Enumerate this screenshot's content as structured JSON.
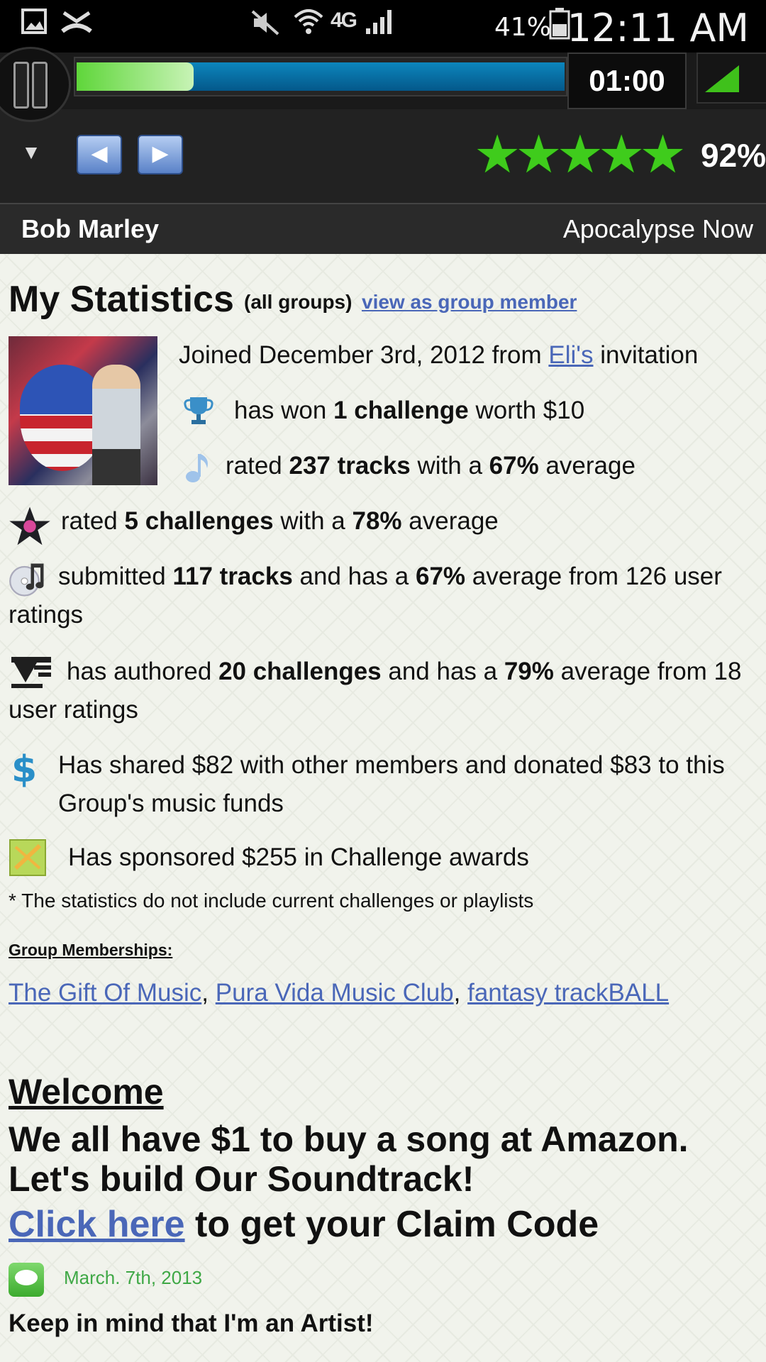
{
  "status_bar": {
    "time": "12:11 AM",
    "battery": "41%",
    "network": "4G",
    "icons": [
      "gallery-icon",
      "missed-call-icon",
      "mute-icon",
      "wifi-icon",
      "signal-icon",
      "battery-icon"
    ]
  },
  "player": {
    "elapsed": "01:00",
    "progress_fraction": 0.24,
    "rating_stars": 5,
    "rating_percent": "92%",
    "artist": "Bob Marley",
    "song": "Apocalypse Now",
    "controls": [
      "pause-icon",
      "dropdown-icon",
      "previous-icon",
      "next-icon",
      "volume-icon"
    ],
    "accent": "#3fcc1c",
    "progress_color": "#0c86bd"
  },
  "stats": {
    "title": "My Statistics",
    "scope": "(all groups)",
    "view_link": "view as group member",
    "joined_prefix": "Joined December 3rd, 2012 from ",
    "joined_link": "Eli's",
    "joined_suffix": " invitation",
    "won_prefix": "has won ",
    "won_bold": "1 challenge",
    "won_suffix": " worth $10",
    "rated_tracks_prefix": "rated ",
    "rated_tracks_bold": "237 tracks",
    "rated_tracks_mid": " with a ",
    "rated_tracks_pct": "67%",
    "rated_tracks_suffix": " average",
    "rated_ch_prefix": "rated ",
    "rated_ch_bold": "5 challenges",
    "rated_ch_mid": " with a ",
    "rated_ch_pct": "78%",
    "rated_ch_suffix": " average",
    "submitted_prefix": "submitted ",
    "submitted_bold": "117 tracks",
    "submitted_mid": " and has a ",
    "submitted_pct": "67%",
    "submitted_suffix": " average from 126 user ratings",
    "authored_prefix": "has authored ",
    "authored_bold": "20 challenges",
    "authored_mid": " and has a ",
    "authored_pct": "79%",
    "authored_suffix": " average from 18 user ratings",
    "shared": "Has shared $82 with other members and donated $83 to this Group's music funds",
    "sponsored": "Has sponsored $255 in Challenge awards",
    "note": "* The statistics do not include current challenges or playlists",
    "memberships_label": "Group Memberships:",
    "groups": [
      "The Gift Of Music",
      "Pura Vida Music Club",
      "fantasy trackBALL"
    ],
    "group_separator": ", "
  },
  "welcome": {
    "heading": "Welcome",
    "line": "We all have $1 to buy a song at Amazon. Let's build Our Soundtrack!",
    "claim_link": "Click here",
    "claim_suffix": " to get your Claim Code"
  },
  "message": {
    "date": "March. 7th, 2013",
    "text": "Keep in mind that I'm an Artist!",
    "link_color": "#4a67b8",
    "date_color": "#3fa846"
  }
}
